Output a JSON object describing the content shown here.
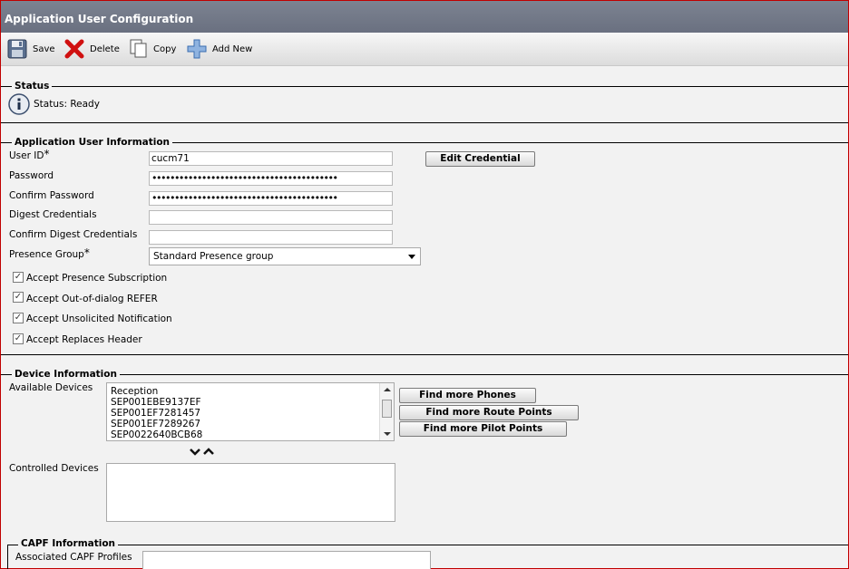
{
  "window": {
    "title": "Application User Configuration"
  },
  "toolbar": {
    "save_label": "Save",
    "delete_label": "Delete",
    "copy_label": "Copy",
    "add_new_label": "Add New"
  },
  "status": {
    "legend": "Status",
    "text": "Status: Ready"
  },
  "app_user": {
    "legend": "Application User Information",
    "user_id_label": "User ID",
    "user_id_value": "cucm71",
    "password_label": "Password",
    "password_value": "•••••••••••••••••••••••••••••••••••••••••",
    "confirm_password_label": "Confirm Password",
    "confirm_password_value": "•••••••••••••••••••••••••••••••••••••••••",
    "digest_label": "Digest Credentials",
    "digest_value": "",
    "confirm_digest_label": "Confirm Digest Credentials",
    "confirm_digest_value": "",
    "presence_group_label": "Presence Group",
    "presence_group_value": "Standard Presence group",
    "edit_credential_label": "Edit Credential",
    "required_mark": "*",
    "checkboxes": [
      {
        "label": "Accept Presence Subscription",
        "checked": true
      },
      {
        "label": "Accept Out-of-dialog REFER",
        "checked": true
      },
      {
        "label": "Accept Unsolicited Notification",
        "checked": true
      },
      {
        "label": "Accept Replaces Header",
        "checked": true
      }
    ]
  },
  "device": {
    "legend": "Device Information",
    "available_label": "Available Devices",
    "available_items": [
      "Reception",
      "SEP001EBE9137EF",
      "SEP001EF7281457",
      "SEP001EF7289267",
      "SEP0022640BCB68"
    ],
    "find_phones_label": "Find more Phones",
    "find_route_points_label": "Find more Route Points",
    "find_pilot_points_label": "Find more Pilot Points",
    "controlled_label": "Controlled Devices",
    "controlled_items": []
  },
  "capf": {
    "legend": "CAPF Information",
    "profiles_label": "Associated CAPF Profiles"
  },
  "colors": {
    "titlebar": "#6f7584",
    "accent_red": "#cc0000"
  }
}
